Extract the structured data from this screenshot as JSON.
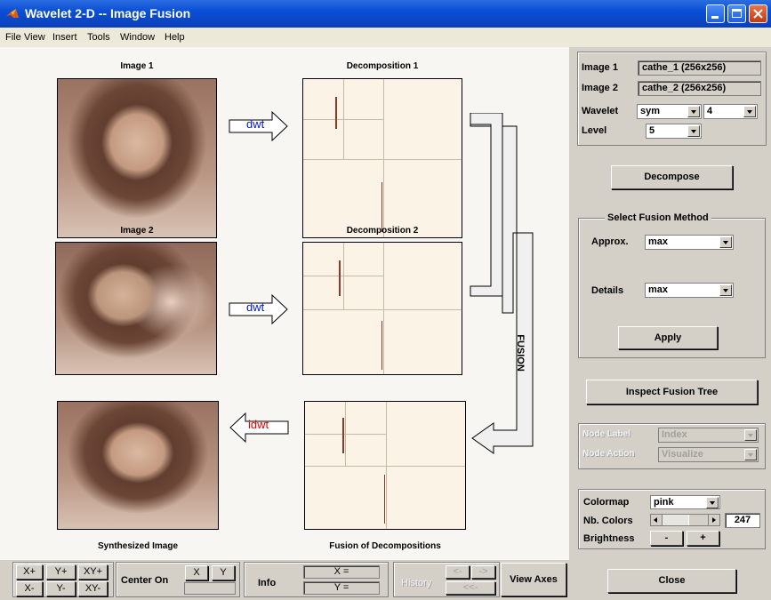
{
  "window": {
    "title": "Wavelet 2-D -- Image Fusion"
  },
  "menu": [
    "File",
    "View",
    "Insert",
    "Tools",
    "Window",
    "Help"
  ],
  "plots": {
    "image1_title": "Image 1",
    "decomp1_title": "Decomposition 1",
    "image2_title": "Image 2",
    "decomp2_title": "Decomposition 2",
    "synth_title": "Synthesized Image",
    "fusion_title": "Fusion of Decompositions",
    "dwt1": "dwt",
    "dwt2": "dwt",
    "idwt": "idwt",
    "fusion_label": "FUSION"
  },
  "info": {
    "image1_label": "Image 1",
    "image1_value": "cathe_1  (256x256)",
    "image2_label": "Image 2",
    "image2_value": "cathe_2  (256x256)",
    "wavelet_label": "Wavelet",
    "wavelet_family": "sym",
    "wavelet_order": "4",
    "level_label": "Level",
    "level_value": "5"
  },
  "buttons": {
    "decompose": "Decompose",
    "apply": "Apply",
    "inspect": "Inspect Fusion Tree",
    "close": "Close",
    "view_axes": "View Axes",
    "info": "Info"
  },
  "fusion_method": {
    "title": "Select Fusion Method",
    "approx_label": "Approx.",
    "approx_value": "max",
    "details_label": "Details",
    "details_value": "max"
  },
  "node": {
    "label_label": "Node Label",
    "label_value": "Index",
    "action_label": "Node Action",
    "action_value": "Visualize"
  },
  "colormap": {
    "colormap_label": "Colormap",
    "colormap_value": "pink",
    "ncolors_label": "Nb. Colors",
    "ncolors_value": "247",
    "ncolors_fraction": 0.96,
    "brightness_label": "Brightness",
    "minus": "-",
    "plus": "+"
  },
  "bottom": {
    "zoom": [
      "X+",
      "Y+",
      "XY+",
      "X-",
      "Y-",
      "XY-"
    ],
    "center_on": "Center On",
    "center_x": "X",
    "center_y": "Y",
    "x_readout": "X =",
    "y_readout": "Y =",
    "history": "History",
    "hist_back": "<-",
    "hist_fwd": "->",
    "hist_first": "<<-"
  }
}
